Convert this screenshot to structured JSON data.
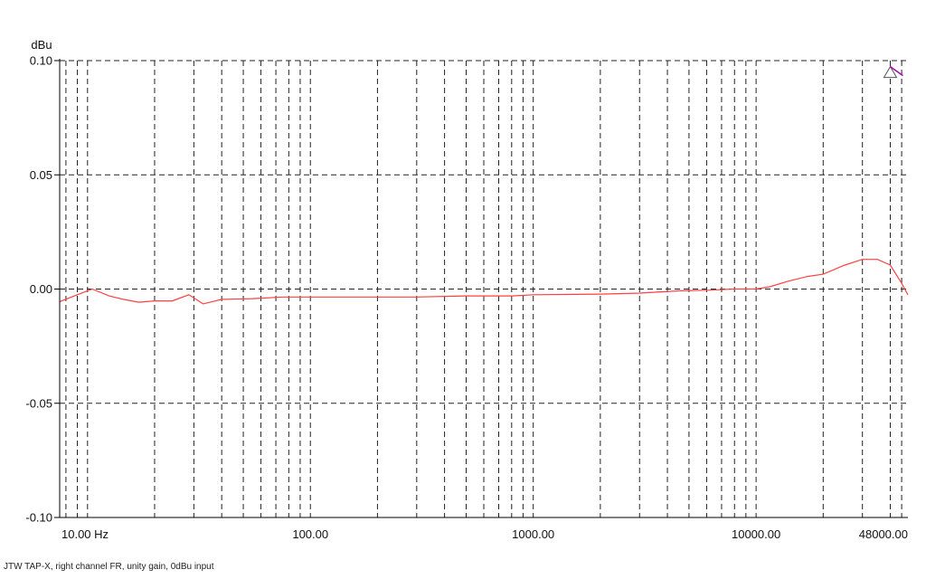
{
  "chart_data": {
    "type": "line",
    "title": "",
    "ylabel": "dBu",
    "xlabel": "",
    "x_scale": "log",
    "xlim": [
      7.5,
      48000
    ],
    "ylim": [
      -0.1,
      0.1
    ],
    "grid": true,
    "x_ticks": [
      {
        "value": 10,
        "label": "10.00 Hz"
      },
      {
        "value": 100,
        "label": "100.00"
      },
      {
        "value": 1000,
        "label": "1000.00"
      },
      {
        "value": 10000,
        "label": "10000.00"
      },
      {
        "value": 48000,
        "label": "48000.00"
      }
    ],
    "y_ticks": [
      {
        "value": 0.1,
        "label": "0.10"
      },
      {
        "value": 0.05,
        "label": "0.05"
      },
      {
        "value": 0.0,
        "label": "0.00"
      },
      {
        "value": -0.05,
        "label": "-0.05"
      },
      {
        "value": -0.1,
        "label": "-0.10"
      }
    ],
    "series": [
      {
        "color": "#ff4040",
        "points": [
          [
            7.5,
            -0.0055
          ],
          [
            9.0,
            -0.0025
          ],
          [
            10.5,
            0.0
          ],
          [
            12.5,
            -0.003
          ],
          [
            14.5,
            -0.0045
          ],
          [
            17.0,
            -0.0058
          ],
          [
            20.0,
            -0.0052
          ],
          [
            24.0,
            -0.0052
          ],
          [
            28.5,
            -0.0025
          ],
          [
            33.0,
            -0.0065
          ],
          [
            40.0,
            -0.0045
          ],
          [
            55.0,
            -0.0042
          ],
          [
            75.0,
            -0.0035
          ],
          [
            100.0,
            -0.0035
          ],
          [
            300.0,
            -0.0035
          ],
          [
            500.0,
            -0.003
          ],
          [
            800.0,
            -0.003
          ],
          [
            1000.0,
            -0.0025
          ],
          [
            2000.0,
            -0.0022
          ],
          [
            3000.0,
            -0.0018
          ],
          [
            4500.0,
            -0.0008
          ],
          [
            6000.0,
            -0.0005
          ],
          [
            8000.0,
            0.0
          ],
          [
            10000.0,
            0.0
          ],
          [
            11500.0,
            0.001
          ],
          [
            14000.0,
            0.0035
          ],
          [
            17000.0,
            0.0055
          ],
          [
            20000.0,
            0.0065
          ],
          [
            25000.0,
            0.0105
          ],
          [
            30000.0,
            0.013
          ],
          [
            35000.0,
            0.013
          ],
          [
            40000.0,
            0.0105
          ],
          [
            45000.0,
            0.0025
          ],
          [
            48000.0,
            -0.0025
          ]
        ]
      }
    ],
    "markers": [
      {
        "type": "triangle-cursor",
        "x": 40000,
        "y": 0.095,
        "color": "#555555"
      }
    ]
  },
  "footer": {
    "caption": "JTW TAP-X, right channel FR, unity gain, 0dBu input"
  }
}
